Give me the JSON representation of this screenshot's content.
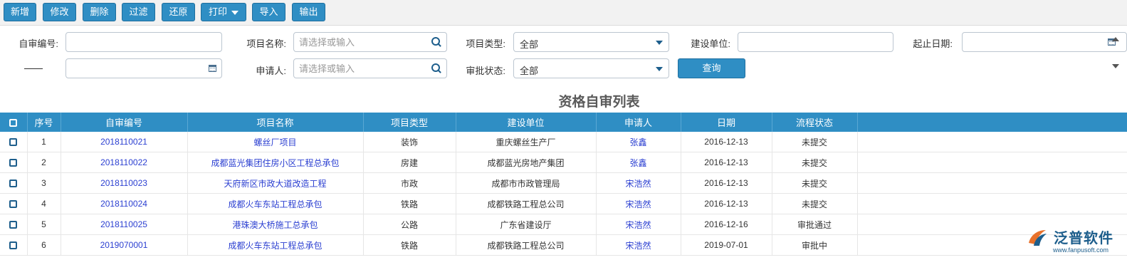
{
  "toolbar": {
    "buttons": [
      "新增",
      "修改",
      "删除",
      "过滤",
      "还原",
      "打印",
      "导入",
      "输出"
    ]
  },
  "filters": {
    "self_review_no": {
      "label": "自审编号:",
      "value": ""
    },
    "project_name": {
      "label": "项目名称:",
      "placeholder": "请选择或输入"
    },
    "project_type": {
      "label": "项目类型:",
      "value": "全部"
    },
    "construction_unit": {
      "label": "建设单位:",
      "value": ""
    },
    "date_range": {
      "label": "起止日期:",
      "separator": "——"
    },
    "applicant": {
      "label": "申请人:",
      "placeholder": "请选择或输入"
    },
    "approval_status": {
      "label": "审批状态:",
      "value": "全部"
    },
    "query_button": "查询"
  },
  "list": {
    "title": "资格自审列表",
    "columns": [
      "序号",
      "自审编号",
      "项目名称",
      "项目类型",
      "建设单位",
      "申请人",
      "日期",
      "流程状态"
    ],
    "rows": [
      {
        "seq": "1",
        "no": "2018110021",
        "project": "螺丝厂项目",
        "type": "装饰",
        "unit": "重庆螺丝生产厂",
        "applicant": "张鑫",
        "date": "2016-12-13",
        "status": "未提交"
      },
      {
        "seq": "2",
        "no": "2018110022",
        "project": "成都蓝光集团住房小区工程总承包",
        "type": "房建",
        "unit": "成都蓝光房地产集团",
        "applicant": "张鑫",
        "date": "2016-12-13",
        "status": "未提交"
      },
      {
        "seq": "3",
        "no": "2018110023",
        "project": "天府新区市政大道改造工程",
        "type": "市政",
        "unit": "成都市市政管理局",
        "applicant": "宋浩然",
        "date": "2016-12-13",
        "status": "未提交"
      },
      {
        "seq": "4",
        "no": "2018110024",
        "project": "成都火车东站工程总承包",
        "type": "铁路",
        "unit": "成都铁路工程总公司",
        "applicant": "宋浩然",
        "date": "2016-12-13",
        "status": "未提交"
      },
      {
        "seq": "5",
        "no": "2018110025",
        "project": "港珠澳大桥施工总承包",
        "type": "公路",
        "unit": "广东省建设厅",
        "applicant": "宋浩然",
        "date": "2016-12-16",
        "status": "审批通过"
      },
      {
        "seq": "6",
        "no": "2019070001",
        "project": "成都火车东站工程总承包",
        "type": "铁路",
        "unit": "成都铁路工程总公司",
        "applicant": "宋浩然",
        "date": "2019-07-01",
        "status": "审批中"
      }
    ]
  },
  "logo": {
    "name": "泛普软件",
    "url": "www.fanpusoft.com"
  },
  "colors": {
    "accent": "#2f8ec4",
    "link": "#2b3fd1",
    "icon": "#1d5e8c"
  }
}
